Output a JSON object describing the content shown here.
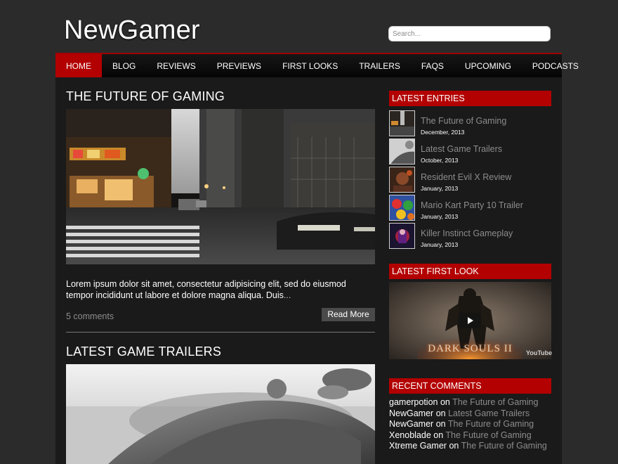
{
  "site": {
    "title": "NewGamer"
  },
  "search": {
    "placeholder": "Search..."
  },
  "nav": {
    "items": [
      {
        "label": "HOME"
      },
      {
        "label": "BLOG"
      },
      {
        "label": "REVIEWS"
      },
      {
        "label": "PREVIEWS"
      },
      {
        "label": "FIRST LOOKS"
      },
      {
        "label": "TRAILERS"
      },
      {
        "label": "FAQS"
      },
      {
        "label": "UPCOMING"
      },
      {
        "label": "PODCASTS"
      }
    ]
  },
  "posts": [
    {
      "title": "THE FUTURE OF GAMING",
      "excerpt": "Lorem ipsum dolor sit amet, consectetur adipisicing elit, sed do eiusmod tempor incididunt ut labore et dolore magna aliqua. Duis",
      "more": "...",
      "comments": "5 comments",
      "read_more": "Read More"
    },
    {
      "title": "LATEST GAME TRAILERS"
    }
  ],
  "sidebar": {
    "latest_entries": {
      "title": "LATEST ENTRIES",
      "items": [
        {
          "title": "The Future of Gaming",
          "date": "December, 2013"
        },
        {
          "title": "Latest Game Trailers",
          "date": "October, 2013"
        },
        {
          "title": "Resident Evil X Review",
          "date": "January, 2013"
        },
        {
          "title": "Mario Kart Party 10 Trailer",
          "date": "January, 2013"
        },
        {
          "title": "Killer Instinct Gameplay",
          "date": "January, 2013"
        }
      ]
    },
    "first_look": {
      "title": "LATEST FIRST LOOK",
      "video_text": "DARK SOULS II",
      "logo": "YouTube"
    },
    "recent_comments": {
      "title": "RECENT COMMENTS",
      "on_word": "on",
      "items": [
        {
          "author": "gamerpotion",
          "post": "The Future of Gaming"
        },
        {
          "author": "NewGamer",
          "post": "Latest Game Trailers"
        },
        {
          "author": "NewGamer",
          "post": "The Future of Gaming"
        },
        {
          "author": "Xenoblade",
          "post": "The Future of Gaming"
        },
        {
          "author": "Xtreme Gamer",
          "post": "The Future of Gaming"
        }
      ]
    }
  },
  "colors": {
    "accent": "#b30000",
    "background": "#2b2b2b",
    "content_bg": "#1a1a1a",
    "muted_text": "#8c8c8c"
  }
}
